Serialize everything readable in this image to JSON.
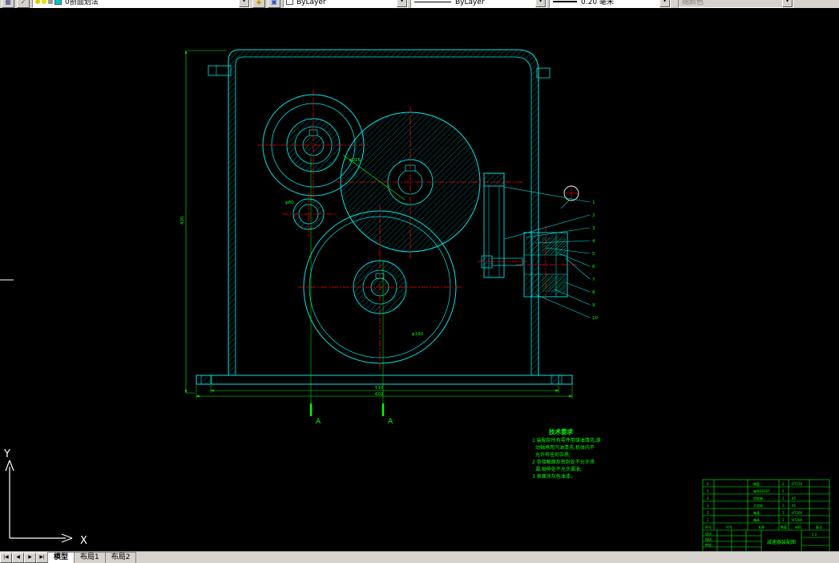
{
  "colors": {
    "cad_cyan": "#00e6e6",
    "cad_green": "#00ff00",
    "cad_red": "#ff0000",
    "chrome": "#d6d3ce",
    "white": "#ffffff"
  },
  "toolbar": {
    "layer_name": "0剖面划法",
    "color_value": "ByLayer",
    "linetype_value": "ByLayer",
    "lineweight_value": "0.20 毫米",
    "plotstyle_value": "随颜色"
  },
  "tabs": {
    "nav": [
      "|◀",
      "◀",
      "▶",
      "▶|"
    ],
    "items": [
      "模型",
      "布局1",
      "布局2"
    ],
    "active": "模型"
  },
  "ucs": {
    "x": "X",
    "y": "Y"
  },
  "tech_notes": {
    "title": "技术要求",
    "lines": [
      "1 装配前所有零件用煤油清洗,滚",
      "动轴承用汽油清洗,机体内不",
      "允许有任何杂质;",
      "2 各接触面及密封处不允许渗",
      "漏,轴伸处不允许漏油;",
      "3 表面涂灰色油漆。"
    ]
  },
  "dims": {
    "left_height": "430",
    "base_inner": "510",
    "base_outer": "602",
    "gear_b": "φ216",
    "gear_d": "φ190",
    "shaft": "φ80"
  },
  "section_marks": [
    "A",
    "A"
  ],
  "parts": [
    "1",
    "2",
    "3",
    "4",
    "5",
    "6",
    "7",
    "8",
    "9",
    "10"
  ],
  "title_block": {
    "header": {
      "no": "序号",
      "code": "代号",
      "name": "名称",
      "qty": "数量",
      "mat": "材料",
      "note": "备注"
    },
    "rows": [
      {
        "no": "6",
        "name": "端盖",
        "qty": "2",
        "mat": "HT150"
      },
      {
        "no": "5",
        "name": "轴承30207",
        "qty": "2",
        "mat": ""
      },
      {
        "no": "4",
        "name": "齿轮轴",
        "qty": "1",
        "mat": "45"
      },
      {
        "no": "3",
        "name": "大齿轮",
        "qty": "1",
        "mat": "45"
      },
      {
        "no": "2",
        "name": "箱盖",
        "qty": "1",
        "mat": "HT200"
      },
      {
        "no": "1",
        "name": "箱体",
        "qty": "1",
        "mat": "HT200"
      }
    ],
    "title": "减速器装配图",
    "scale": "1:2",
    "sig": [
      "设计",
      "校核",
      "审核"
    ]
  }
}
